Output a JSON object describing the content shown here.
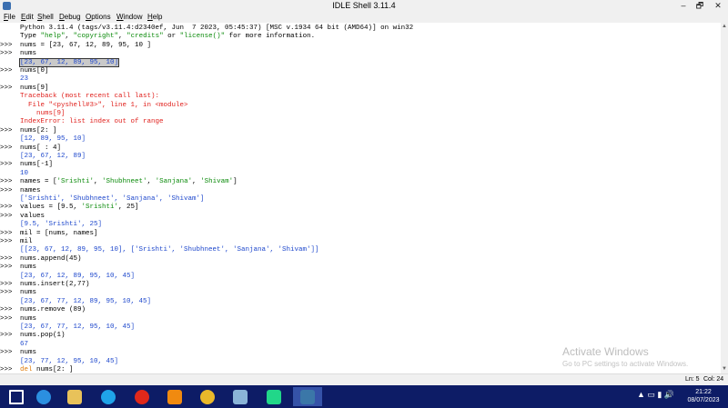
{
  "window": {
    "title": "IDLE Shell 3.11.4",
    "controls": {
      "minimize": "–",
      "maximize": "🗗",
      "close": "✕"
    }
  },
  "menu": [
    "File",
    "Edit",
    "Shell",
    "Debug",
    "Options",
    "Window",
    "Help"
  ],
  "menu_underline": [
    "F",
    "E",
    "S",
    "D",
    "O",
    "W",
    "H"
  ],
  "prompt_symbol": ">>>",
  "shell_lines": [
    {
      "prompt": false,
      "kind": "plain",
      "text": "Python 3.11.4 (tags/v3.11.4:d2340ef, Jun  7 2023, 05:45:37) [MSC v.1934 64 bit (AMD64)] on win32"
    },
    {
      "prompt": false,
      "kind": "plain_mixed",
      "text": "Type \"help\", \"copyright\", \"credits\" or \"license()\" for more information."
    },
    {
      "prompt": true,
      "kind": "input",
      "text": "nums = [23, 67, 12, 89, 95, 10 ]"
    },
    {
      "prompt": true,
      "kind": "input",
      "text": "nums"
    },
    {
      "prompt": false,
      "kind": "out_selected",
      "text": "[23, 67, 12, 89, 95, 10]"
    },
    {
      "prompt": true,
      "kind": "input",
      "text": "nums[0]"
    },
    {
      "prompt": false,
      "kind": "out",
      "text": "23"
    },
    {
      "prompt": true,
      "kind": "input",
      "text": "nums[9]"
    },
    {
      "prompt": false,
      "kind": "err",
      "text": "Traceback (most recent call last):"
    },
    {
      "prompt": false,
      "kind": "err",
      "text": "  File \"<pyshell#3>\", line 1, in <module>"
    },
    {
      "prompt": false,
      "kind": "err",
      "text": "    nums[9]"
    },
    {
      "prompt": false,
      "kind": "err",
      "text": "IndexError: list index out of range"
    },
    {
      "prompt": true,
      "kind": "input",
      "text": "nums[2: ]"
    },
    {
      "prompt": false,
      "kind": "out",
      "text": "[12, 89, 95, 10]"
    },
    {
      "prompt": true,
      "kind": "input",
      "text": "nums[ : 4]"
    },
    {
      "prompt": false,
      "kind": "out",
      "text": "[23, 67, 12, 89]"
    },
    {
      "prompt": true,
      "kind": "input",
      "text": "nums[-1]"
    },
    {
      "prompt": false,
      "kind": "out",
      "text": "10"
    },
    {
      "prompt": true,
      "kind": "input_str",
      "text": "names = ['Srishti', 'Shubhneet', 'Sanjana', 'Shivam']"
    },
    {
      "prompt": true,
      "kind": "input",
      "text": "names"
    },
    {
      "prompt": false,
      "kind": "out",
      "text": "['Srishti', 'Shubhneet', 'Sanjana', 'Shivam']"
    },
    {
      "prompt": true,
      "kind": "input_str",
      "text": "values = [9.5, 'Srishti', 25]"
    },
    {
      "prompt": true,
      "kind": "input",
      "text": "values"
    },
    {
      "prompt": false,
      "kind": "out",
      "text": "[9.5, 'Srishti', 25]"
    },
    {
      "prompt": true,
      "kind": "input",
      "text": "mil = [nums, names]"
    },
    {
      "prompt": true,
      "kind": "input",
      "text": "mil"
    },
    {
      "prompt": false,
      "kind": "out",
      "text": "[[23, 67, 12, 89, 95, 10], ['Srishti', 'Shubhneet', 'Sanjana', 'Shivam']]"
    },
    {
      "prompt": true,
      "kind": "input",
      "text": "nums.append(45)"
    },
    {
      "prompt": true,
      "kind": "input",
      "text": "nums"
    },
    {
      "prompt": false,
      "kind": "out",
      "text": "[23, 67, 12, 89, 95, 10, 45]"
    },
    {
      "prompt": true,
      "kind": "input",
      "text": "nums.insert(2,77)"
    },
    {
      "prompt": true,
      "kind": "input",
      "text": "nums"
    },
    {
      "prompt": false,
      "kind": "out",
      "text": "[23, 67, 77, 12, 89, 95, 10, 45]"
    },
    {
      "prompt": true,
      "kind": "input",
      "text": "nums.remove (89)"
    },
    {
      "prompt": true,
      "kind": "input",
      "text": "nums"
    },
    {
      "prompt": false,
      "kind": "out",
      "text": "[23, 67, 77, 12, 95, 10, 45]"
    },
    {
      "prompt": true,
      "kind": "input",
      "text": "nums.pop(1)"
    },
    {
      "prompt": false,
      "kind": "out",
      "text": "67"
    },
    {
      "prompt": true,
      "kind": "input",
      "text": "nums"
    },
    {
      "prompt": false,
      "kind": "out",
      "text": "[23, 77, 12, 95, 10, 45]"
    },
    {
      "prompt": true,
      "kind": "input_del",
      "text": "nums[2: ]"
    }
  ],
  "del_keyword": "del",
  "watermark": {
    "title": "Activate Windows",
    "subtitle": "Go to PC settings to activate Windows."
  },
  "status": {
    "ln": "Ln: 5",
    "col": "Col: 24"
  },
  "taskbar": {
    "items": [
      {
        "name": "windows-start-icon",
        "color": "#ffffff"
      },
      {
        "name": "internet-explorer-icon",
        "color": "#2b8fe0"
      },
      {
        "name": "file-explorer-icon",
        "color": "#e8c25a"
      },
      {
        "name": "edge-icon",
        "color": "#1fa3e8"
      },
      {
        "name": "opera-icon",
        "color": "#e0281a"
      },
      {
        "name": "vlc-icon",
        "color": "#f08a10"
      },
      {
        "name": "chrome-icon",
        "color": "#e9b82a"
      },
      {
        "name": "notepad-icon",
        "color": "#8ab4d8"
      },
      {
        "name": "pycharm-icon",
        "color": "#21d789"
      },
      {
        "name": "python-idle-icon",
        "color": "#3b77a8"
      }
    ],
    "tray_glyphs": "▲ ▭ ▮ 🔊",
    "time": "21:22",
    "date": "08/07/2023"
  }
}
